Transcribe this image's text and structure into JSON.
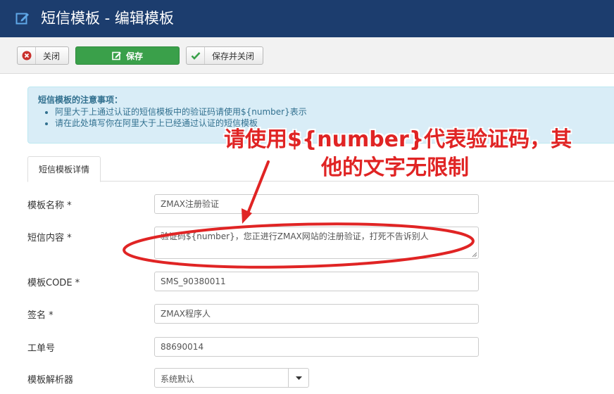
{
  "header": {
    "title": "短信模板 - 编辑模板"
  },
  "toolbar": {
    "close_label": "关闭",
    "save_label": "保存",
    "save_close_label": "保存并关闭"
  },
  "notice": {
    "title": "短信模板的注意事项：",
    "items": [
      "阿里大于上通过认证的短信模板中的验证码请使用${number}表示",
      "请在此处填写你在阿里大于上已经通过认证的短信模板"
    ]
  },
  "tabs": [
    {
      "label": "短信模板详情"
    }
  ],
  "form": {
    "name_label": "模板名称 *",
    "name_value": "ZMAX注册验证",
    "content_label": "短信内容 *",
    "content_value": "验证码${number}，您正进行ZMAX网站的注册验证，打死不告诉别人",
    "code_label": "模板CODE *",
    "code_value": "SMS_90380011",
    "sign_label": "签名 *",
    "sign_value": "ZMAX程序人",
    "order_label": "工单号",
    "order_value": "88690014",
    "parser_label": "模板解析器",
    "parser_value": "系统默认"
  },
  "annotation": {
    "line1": "请使用${number}代表验证码，其",
    "line2": "他的文字无限制",
    "color": "#e02424"
  }
}
